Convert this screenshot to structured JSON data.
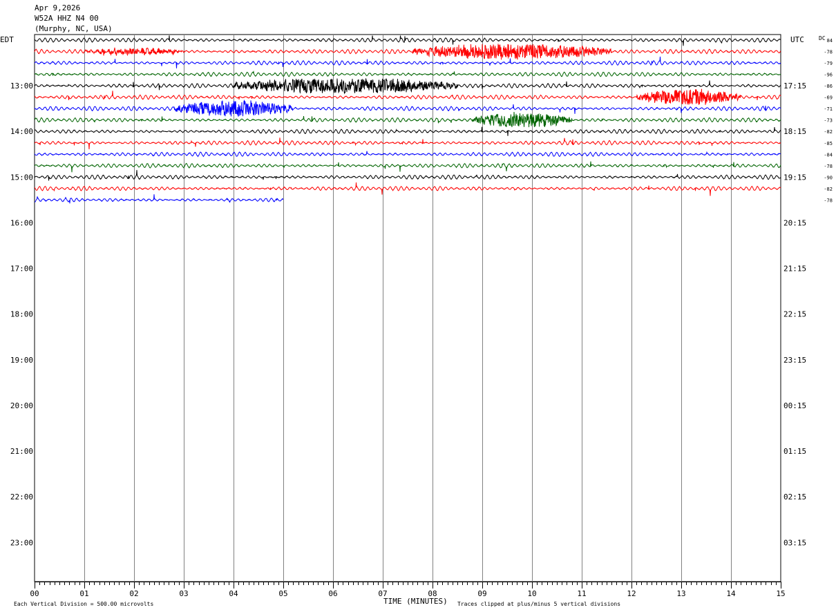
{
  "header": {
    "date": "Apr 9,2026",
    "station": "W52A HHZ N4 00",
    "location": "(Murphy, NC, USA)"
  },
  "left_timezone": "EDT",
  "right_timezone": "UTC",
  "dc_label": "DC",
  "footer": {
    "scale_note": "Each Vertical Division =  500.00 microvolts",
    "xlabel": "TIME (MINUTES)",
    "clip_note": "Traces clipped at plus/minus 5 vertical divisions"
  },
  "colors": {
    "black": "#000000",
    "red": "#ff0000",
    "blue": "#0000ff",
    "green": "#006400",
    "grid": "#808080"
  },
  "chart_data": {
    "type": "line",
    "title": "W52A HHZ N4 00",
    "xlabel": "TIME (MINUTES)",
    "xlim": [
      0,
      15
    ],
    "x_ticks": [
      "00",
      "01",
      "02",
      "03",
      "04",
      "05",
      "06",
      "07",
      "08",
      "09",
      "10",
      "11",
      "12",
      "13",
      "14",
      "15"
    ],
    "left_time_labels": [
      "13:00",
      "14:00",
      "15:00",
      "16:00",
      "17:00",
      "18:00",
      "19:00",
      "20:00",
      "21:00",
      "22:00",
      "23:00"
    ],
    "right_time_labels": [
      "17:15",
      "18:15",
      "19:15",
      "20:15",
      "21:15",
      "22:15",
      "23:15",
      "00:15",
      "01:15",
      "02:15",
      "03:15"
    ],
    "traces_per_hour": 4,
    "trace_minutes": 15,
    "trace_color_cycle": [
      "black",
      "red",
      "blue",
      "green"
    ],
    "dc_offsets": [
      "84",
      "-78",
      "-79",
      "-96",
      "-86",
      "-69",
      "-71",
      "-73",
      "-82",
      "-85",
      "-84",
      "-78",
      "-90",
      "-82",
      "-78"
    ],
    "last_trace_end_minute": 5.0,
    "events": [
      {
        "trace": 1,
        "start_min": 1.0,
        "end_min": 3.0,
        "amplitude": 0.4
      },
      {
        "trace": 1,
        "start_min": 7.6,
        "end_min": 11.6,
        "amplitude": 1.0
      },
      {
        "trace": 4,
        "start_min": 4.0,
        "end_min": 8.5,
        "amplitude": 1.0
      },
      {
        "trace": 5,
        "start_min": 12.1,
        "end_min": 14.2,
        "amplitude": 1.0
      },
      {
        "trace": 6,
        "start_min": 2.8,
        "end_min": 5.2,
        "amplitude": 1.0
      },
      {
        "trace": 7,
        "start_min": 8.8,
        "end_min": 10.8,
        "amplitude": 1.0
      }
    ]
  }
}
